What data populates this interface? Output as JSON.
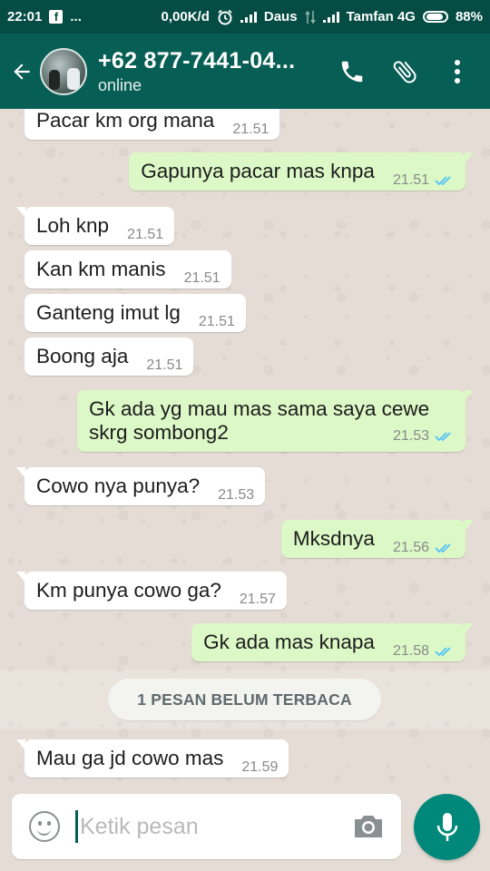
{
  "status_bar": {
    "time": "22:01",
    "dots": "...",
    "speed": "0,00K/d",
    "carrier1": "Daus",
    "carrier2": "Tamfan 4G",
    "battery": "88%"
  },
  "header": {
    "contact": "+62 877-7441-04...",
    "status": "online"
  },
  "messages": [
    {
      "dir": "in",
      "text": "Pacar km org mana",
      "time": "21.51"
    },
    {
      "dir": "out",
      "text": "Gapunya pacar mas knpa",
      "time": "21.51"
    },
    {
      "dir": "in",
      "text": "Loh knp",
      "time": "21.51"
    },
    {
      "dir": "in",
      "text": "Kan km manis",
      "time": "21.51"
    },
    {
      "dir": "in",
      "text": "Ganteng imut lg",
      "time": "21.51"
    },
    {
      "dir": "in",
      "text": "Boong aja",
      "time": "21.51"
    },
    {
      "dir": "out",
      "text_line1": "Gk ada yg mau mas sama saya cewe",
      "text_line2": "skrg sombong2",
      "time": "21.53"
    },
    {
      "dir": "in",
      "text": "Cowo nya punya?",
      "time": "21.53"
    },
    {
      "dir": "out",
      "text": "Mksdnya",
      "time": "21.56"
    },
    {
      "dir": "in",
      "text": "Km punya cowo ga?",
      "time": "21.57"
    },
    {
      "dir": "out",
      "text": "Gk ada mas knapa",
      "time": "21.58"
    },
    {
      "dir": "in",
      "text": "Mau ga jd cowo mas",
      "time": "21.59"
    }
  ],
  "unread_label": "1 PESAN BELUM TERBACA",
  "composer": {
    "placeholder": "Ketik pesan"
  },
  "colors": {
    "header": "#075e54",
    "status_bar": "#054d44",
    "outgoing_bubble": "#dcf8c6",
    "incoming_bubble": "#ffffff",
    "read_ticks": "#4fc3f7",
    "mic_button": "#00897b"
  },
  "icons": [
    "back-arrow-icon",
    "phone-icon",
    "attach-icon",
    "more-vert-icon",
    "emoji-icon",
    "camera-icon",
    "mic-icon",
    "double-check-icon"
  ]
}
